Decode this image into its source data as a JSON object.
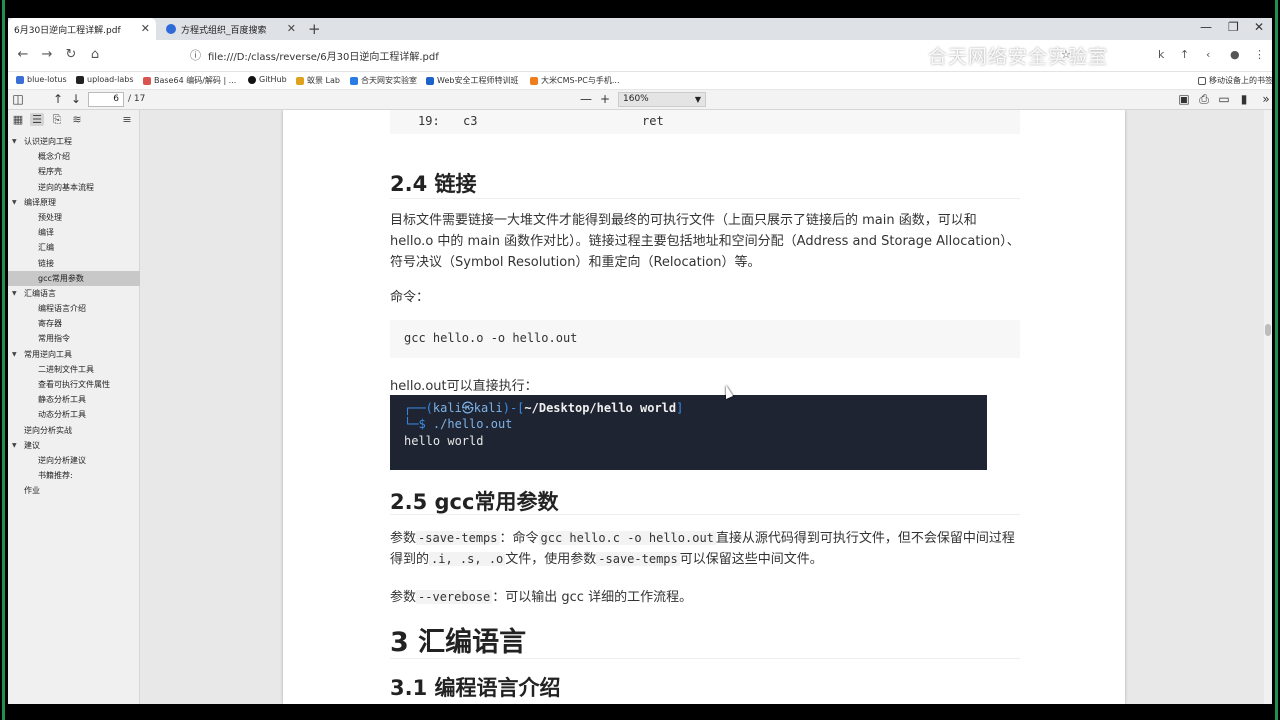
{
  "browser": {
    "tabs": [
      {
        "title": "6月30日逆向工程详解.pdf",
        "active": true
      },
      {
        "title": "方程式组织_百度搜索",
        "active": false
      }
    ],
    "url": "file:///D:/class/reverse/6月30日逆向工程详解.pdf",
    "watermark": "合天网络安全实验室",
    "bookmarks": [
      "blue-lotus",
      "upload-labs",
      "Base64 编码/解码 | ...",
      "GitHub",
      "蚁景 Lab",
      "合天网安实验室",
      "Web安全工程师特训班",
      "大米CMS-PC与手机..."
    ],
    "mobile_bookmarks": "移动设备上的书签"
  },
  "pdf_toolbar": {
    "page_current": "6",
    "page_total": "/ 17",
    "zoom": "160%"
  },
  "outline": [
    {
      "label": "认识逆向工程",
      "level": 0,
      "expanded": true
    },
    {
      "label": "概念介绍",
      "level": 1
    },
    {
      "label": "程序壳",
      "level": 1
    },
    {
      "label": "逆向的基本流程",
      "level": 1
    },
    {
      "label": "编译原理",
      "level": 0,
      "expanded": true
    },
    {
      "label": "预处理",
      "level": 1
    },
    {
      "label": "编译",
      "level": 1
    },
    {
      "label": "汇编",
      "level": 1
    },
    {
      "label": "链接",
      "level": 1
    },
    {
      "label": "gcc常用参数",
      "level": 1,
      "selected": true
    },
    {
      "label": "汇编语言",
      "level": 0,
      "expanded": true
    },
    {
      "label": "编程语言介绍",
      "level": 1
    },
    {
      "label": "寄存器",
      "level": 1
    },
    {
      "label": "常用指令",
      "level": 1
    },
    {
      "label": "常用逆向工具",
      "level": 0,
      "expanded": true
    },
    {
      "label": "二进制文件工具",
      "level": 1
    },
    {
      "label": "查看可执行文件属性",
      "level": 1
    },
    {
      "label": "静态分析工具",
      "level": 1
    },
    {
      "label": "动态分析工具",
      "level": 1
    },
    {
      "label": "逆向分析实战",
      "level": 0
    },
    {
      "label": "建议",
      "level": 0,
      "expanded": true
    },
    {
      "label": "逆向分析建议",
      "level": 1
    },
    {
      "label": "书籍推荐:",
      "level": 1
    },
    {
      "label": "作业",
      "level": 0
    }
  ],
  "doc": {
    "code_top": {
      "num": "19:",
      "hex": "c3",
      "ins": "ret"
    },
    "h_24": "2.4 链接",
    "p_link": "目标文件需要链接一大堆文件才能得到最终的可执行文件（上面只展示了链接后的 main 函数，可以和 hello.o 中的 main 函数作对比）。链接过程主要包括地址和空间分配（Address and Storage Allocation）、符号决议（Symbol Resolution）和重定向（Relocation）等。",
    "cmd_label": "命令：",
    "cmd": "gcc hello.o -o hello.out",
    "run_label": "hello.out可以直接执行：",
    "terminal": {
      "prompt_prefix": "┌──(",
      "user": "kali㉿kali",
      "prompt_mid": ")-[",
      "path": "~/Desktop/hello world",
      "prompt_end": "]",
      "dollar": "└─$",
      "command": "./hello.out",
      "output": "hello world"
    },
    "h_25": "2.5 gcc常用参数",
    "p_save_a": "参数",
    "p_save_flag": "-save-temps",
    "p_save_b": "：命令",
    "p_save_cmd": "gcc hello.c -o hello.out",
    "p_save_c": "直接从源代码得到可执行文件，但不会保留中间过程得到的",
    "p_save_ext": ".i, .s, .o",
    "p_save_d": "文件，使用参数",
    "p_save_flag2": "-save-temps",
    "p_save_e": "可以保留这些中间文件。",
    "p_verb_a": "参数",
    "p_verb_flag": "--verebose",
    "p_verb_b": "：可以输出 gcc 详细的工作流程。",
    "h_3": "3 汇编语言",
    "h_31": "3.1 编程语言介绍"
  }
}
